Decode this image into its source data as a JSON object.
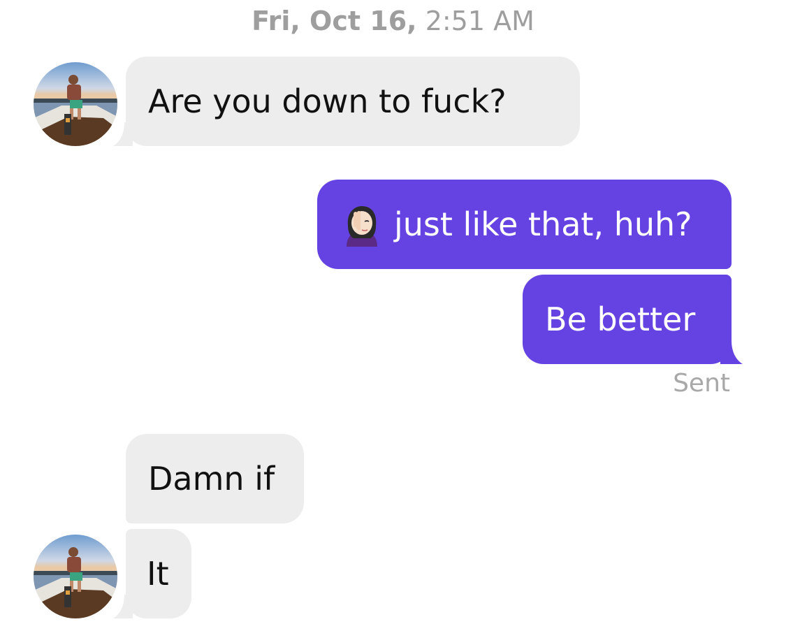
{
  "header": {
    "date": "Fri, Oct 16,",
    "time": "2:51 AM"
  },
  "colors": {
    "incoming_bubble": "#ededed",
    "outgoing_bubble": "#6543e3",
    "timestamp_text": "#9e9e9e",
    "status_text": "#a8a8a8"
  },
  "messages": [
    {
      "direction": "incoming",
      "text": "Are you down to fuck?"
    },
    {
      "direction": "outgoing",
      "emoji": "woman-facepalming-emoji",
      "text": "just like that, huh?"
    },
    {
      "direction": "outgoing",
      "text": "Be better"
    },
    {
      "direction": "incoming",
      "text": "Damn if"
    },
    {
      "direction": "incoming",
      "text": "It"
    }
  ],
  "status": {
    "sent": "Sent"
  }
}
